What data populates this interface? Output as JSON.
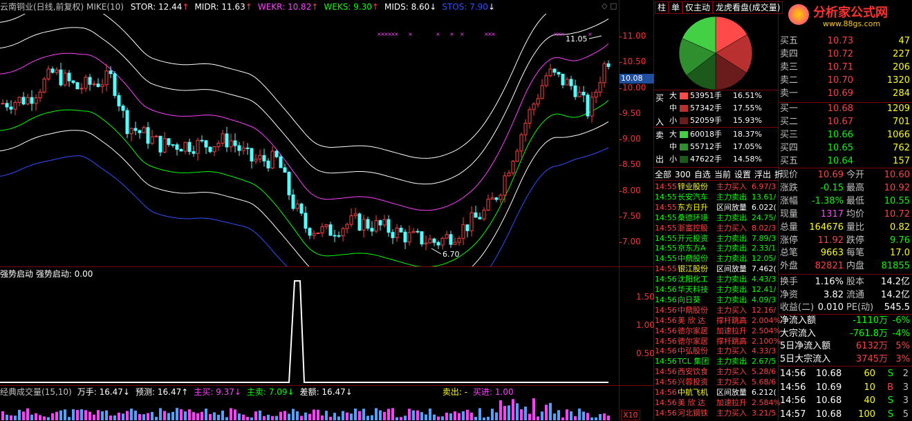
{
  "main_chart": {
    "header": {
      "title": "云南铜业(日线,前复权) MIKE(10)",
      "items": [
        {
          "text": "STOR: 12.44",
          "arrow": "↑",
          "color": "#ffffff",
          "arrow_color": "#ff4040"
        },
        {
          "text": "MIDR: 11.63",
          "arrow": "↑",
          "color": "#ffffff",
          "arrow_color": "#ff4040"
        },
        {
          "text": "WEKR: 10.82",
          "arrow": "↑",
          "color": "#ff40ff",
          "arrow_color": "#ff4040"
        },
        {
          "text": "WEKS: 9.30",
          "arrow": "↑",
          "color": "#00ff00",
          "arrow_color": "#ff4040"
        },
        {
          "text": "MIDS: 8.60",
          "arrow": "↓",
          "color": "#ffffff",
          "arrow_color": "#ffffff"
        },
        {
          "text": "STOS: 7.90",
          "arrow": "↓",
          "color": "#3050ff",
          "arrow_color": "#ffffff"
        }
      ]
    },
    "price_axis": [
      "11.00",
      "10.50",
      "10.00",
      "9.50",
      "9.00",
      "8.50",
      "8.00",
      "7.50",
      "7.00"
    ],
    "current_price_tag": "10.08",
    "high_label": "11.05",
    "low_label": "6.70"
  },
  "indicator1": {
    "label": "强势启动 强势启动: 0.00",
    "axis": [
      "1.50",
      "1.00",
      "0.50"
    ]
  },
  "indicator2": {
    "items": [
      {
        "text": "经典成交量(15,10)",
        "color": "#c0c0c0"
      },
      {
        "text": "万手: 16.47↓",
        "color": "#ffffff"
      },
      {
        "text": "预测: 16.47↑",
        "color": "#ffffff"
      },
      {
        "text": "主买: 9.37↓",
        "color": "#ff40ff"
      },
      {
        "text": "主卖: 7.09↓",
        "color": "#00ff00"
      },
      {
        "text": "差额: 16.47↓",
        "color": "#ffffff"
      },
      {
        "text": "卖出: -",
        "color": "#ffff00"
      },
      {
        "text": "买进: 1.00",
        "color": "#ff40ff"
      }
    ],
    "scale_label": "X10"
  },
  "top_tabs": [
    "柱",
    "单",
    "仅主动",
    "龙虎看盘(成交量)"
  ],
  "logo": {
    "name": "分析家公式网",
    "url": "www.88gs.com"
  },
  "pie_chart": {
    "slices": [
      {
        "name": "买大",
        "value": 16.51,
        "color": "#ff4a4a"
      },
      {
        "name": "买中",
        "value": 17.55,
        "color": "#b83030"
      },
      {
        "name": "买小",
        "value": 15.93,
        "color": "#6a1c1c"
      },
      {
        "name": "卖小",
        "value": 14.58,
        "color": "#1c5a1c"
      },
      {
        "name": "卖中",
        "value": 17.05,
        "color": "#2f8f2f"
      },
      {
        "name": "卖大",
        "value": 18.37,
        "color": "#44d044"
      }
    ]
  },
  "flow": {
    "buy_side_label": [
      "买",
      "入"
    ],
    "sell_side_label": [
      "卖",
      "出"
    ],
    "buy": [
      {
        "size": "大",
        "amount": "53951手",
        "pct": "16.51%",
        "color": "#ff4a4a"
      },
      {
        "size": "中",
        "amount": "57342手",
        "pct": "17.55%",
        "color": "#b83030"
      },
      {
        "size": "小",
        "amount": "52059手",
        "pct": "15.93%",
        "color": "#6a1c1c"
      }
    ],
    "sell": [
      {
        "size": "大",
        "amount": "60018手",
        "pct": "18.37%",
        "color": "#44d044"
      },
      {
        "size": "中",
        "amount": "55712手",
        "pct": "17.05%",
        "color": "#2f8f2f"
      },
      {
        "size": "小",
        "amount": "47622手",
        "pct": "14.58%",
        "color": "#1c5a1c"
      }
    ]
  },
  "filter_tabs": [
    "全部",
    "300",
    "自选",
    "当前",
    "设置",
    "浮出",
    "折"
  ],
  "ticks": [
    {
      "time": "14:55",
      "name": "锌业股份",
      "action": "主力买入",
      "value": "6.97/3",
      "nc": "#ffff00",
      "ac": "#ff4040"
    },
    {
      "time": "14:55",
      "name": "长安汽车",
      "action": "主力卖出",
      "value": "13.61/",
      "nc": "#00ff00",
      "ac": "#00ff00"
    },
    {
      "time": "14:55",
      "name": "东方日升",
      "action": "区间放量",
      "value": "6.022(",
      "nc": "#ffff00",
      "ac": "#ffffff"
    },
    {
      "time": "14:55",
      "name": "桑德环境",
      "action": "主力卖出",
      "value": "24.75/",
      "nc": "#00ff00",
      "ac": "#00ff00"
    },
    {
      "time": "14:55",
      "name": "浙富控股",
      "action": "主力买入",
      "value": "8.02/3",
      "nc": "#ff4040",
      "ac": "#ff4040"
    },
    {
      "time": "14:55",
      "name": "开元投资",
      "action": "主力卖出",
      "value": "7.89/3",
      "nc": "#00ff00",
      "ac": "#00ff00"
    },
    {
      "time": "14:55",
      "name": "京东方A",
      "action": "主力卖出",
      "value": "2.33/1",
      "nc": "#00ff00",
      "ac": "#00ff00"
    },
    {
      "time": "14:55",
      "name": "中鼎股份",
      "action": "主力卖出",
      "value": "12.05/",
      "nc": "#00ff00",
      "ac": "#00ff00"
    },
    {
      "time": "14:55",
      "name": "银江股份",
      "action": "区间放量",
      "value": "7.462(",
      "nc": "#ffff00",
      "ac": "#ffffff"
    },
    {
      "time": "14:56",
      "name": "沈阳化工",
      "action": "主力卖出",
      "value": "4.43/3",
      "nc": "#00ff00",
      "ac": "#00ff00"
    },
    {
      "time": "14:56",
      "name": "华天科技",
      "action": "主力卖出",
      "value": "12.41/",
      "nc": "#00ff00",
      "ac": "#00ff00"
    },
    {
      "time": "14:56",
      "name": "向日葵",
      "action": "主力卖出",
      "value": "4.09/3",
      "nc": "#00ff00",
      "ac": "#00ff00"
    },
    {
      "time": "14:56",
      "name": "中鼎股份",
      "action": "主力买入",
      "value": "12.16/",
      "nc": "#ff4040",
      "ac": "#ff4040"
    },
    {
      "time": "14:56",
      "name": "美 欣 达",
      "action": "撑杆跳高",
      "value": "2.004%",
      "nc": "#ff4040",
      "ac": "#ff4040"
    },
    {
      "time": "14:56",
      "name": "德尔家居",
      "action": "加速拉升",
      "value": "2.504%",
      "nc": "#ff4040",
      "ac": "#ff4040"
    },
    {
      "time": "14:56",
      "name": "德尔家居",
      "action": "撑杆跳高",
      "value": "2.100%",
      "nc": "#ff4040",
      "ac": "#ff4040"
    },
    {
      "time": "14:56",
      "name": "中弘股份",
      "action": "主力买入",
      "value": "4.33/3",
      "nc": "#ff4040",
      "ac": "#ff4040"
    },
    {
      "time": "14:56",
      "name": "TCL 集团",
      "action": "主力卖出",
      "value": "2.67/5",
      "nc": "#00ff00",
      "ac": "#00ff00"
    },
    {
      "time": "14:56",
      "name": "西安饮食",
      "action": "主力买入",
      "value": "5.28/6",
      "nc": "#ff4040",
      "ac": "#ff4040"
    },
    {
      "time": "14:56",
      "name": "兴蓉投资",
      "action": "主力买入",
      "value": "5.68/6",
      "nc": "#ff4040",
      "ac": "#ff4040"
    },
    {
      "time": "14:56",
      "name": "中航飞机",
      "action": "区间放量",
      "value": "6.212(",
      "nc": "#ffff00",
      "ac": "#ffffff"
    },
    {
      "time": "14:56",
      "name": "美 欣 达",
      "action": "加速拉升",
      "value": "2.584%",
      "nc": "#ff4040",
      "ac": "#ff4040"
    },
    {
      "time": "14:56",
      "name": "河北钢铁",
      "action": "主力买入",
      "value": "3.21/5",
      "nc": "#ff4040",
      "ac": "#ff4040"
    }
  ],
  "order_book": {
    "asks": [
      {
        "label": "买五",
        "price": "10.73",
        "vol": "47"
      },
      {
        "label": "卖四",
        "price": "10.72",
        "vol": "227"
      },
      {
        "label": "卖三",
        "price": "10.71",
        "vol": "206"
      },
      {
        "label": "卖二",
        "price": "10.70",
        "vol": "1320"
      },
      {
        "label": "卖一",
        "price": "10.69",
        "vol": "284"
      }
    ],
    "bids": [
      {
        "label": "买一",
        "price": "10.68",
        "vol": "1209"
      },
      {
        "label": "买二",
        "price": "10.67",
        "vol": "701"
      },
      {
        "label": "买三",
        "price": "10.66",
        "vol": "1066"
      },
      {
        "label": "买四",
        "price": "10.65",
        "vol": "762"
      },
      {
        "label": "买五",
        "price": "10.64",
        "vol": "157"
      }
    ]
  },
  "quote_stats": [
    {
      "l1": "现价",
      "v1": "10.69",
      "c1": "#ff4040",
      "l2": "今开",
      "v2": "10.60",
      "c2": "#ff4040"
    },
    {
      "l1": "涨跌",
      "v1": "-0.15",
      "c1": "#00ff00",
      "l2": "最高",
      "v2": "10.92",
      "c2": "#ff4040"
    },
    {
      "l1": "涨幅",
      "v1": "-1.38%",
      "c1": "#00ff00",
      "l2": "最低",
      "v2": "10.55",
      "c2": "#00ff00"
    },
    {
      "l1": "现量",
      "v1": "1317",
      "c1": "#ff40ff",
      "l2": "均价",
      "v2": "10.72",
      "c2": "#ff4040"
    },
    {
      "l1": "总量",
      "v1": "164676",
      "c1": "#ffff00",
      "l2": "量比",
      "v2": "0.82",
      "c2": "#ffff00"
    },
    {
      "l1": "涨停",
      "v1": "11.92",
      "c1": "#ff4040",
      "l2": "跌停",
      "v2": "9.76",
      "c2": "#00ff00"
    },
    {
      "l1": "总笔",
      "v1": "9663",
      "c1": "#ffff00",
      "l2": "每笔",
      "v2": "17.0",
      "c2": "#ffff00"
    },
    {
      "l1": "外盘",
      "v1": "82821",
      "c1": "#ff4040",
      "l2": "内盘",
      "v2": "81855",
      "c2": "#00ff00"
    }
  ],
  "fundamentals": [
    {
      "l1": "换手",
      "v1": "1.16%",
      "l2": "股本",
      "v2": "14.2亿"
    },
    {
      "l1": "净资",
      "v1": "3.82",
      "l2": "流通",
      "v2": "14.2亿"
    },
    {
      "l1": "收益(二)",
      "v1": "0.010",
      "l2": "PE(动)",
      "v2": "545.5"
    }
  ],
  "fund_flow": [
    {
      "label": "净流入额",
      "value": "-1110万",
      "pct": "-6%",
      "vc": "#00ff00",
      "pc": "#00ff00"
    },
    {
      "label": "大宗流入",
      "value": "-761.8万",
      "pct": "-4%",
      "vc": "#00ff00",
      "pc": "#00ff00"
    },
    {
      "label": "5日净流入额",
      "value": "6132万",
      "pct": "5%",
      "vc": "#ff4040",
      "pc": "#ff4040"
    },
    {
      "label": "5日大宗流入",
      "value": "3745万",
      "pct": "3%",
      "vc": "#ff4040",
      "pc": "#ff4040"
    }
  ],
  "trades": [
    {
      "time": "14:56",
      "price": "10.68",
      "vol": "60",
      "side": "S",
      "sc": "#00ff00",
      "count": "2"
    },
    {
      "time": "14:56",
      "price": "10.69",
      "vol": "10",
      "side": "B",
      "sc": "#ff4040",
      "count": "3"
    },
    {
      "time": "14:56",
      "price": "10.68",
      "vol": "40",
      "side": "S",
      "sc": "#00ff00",
      "count": "3"
    },
    {
      "time": "14:57",
      "price": "10.68",
      "vol": "100",
      "side": "S",
      "sc": "#00ff00",
      "count": "5"
    }
  ]
}
